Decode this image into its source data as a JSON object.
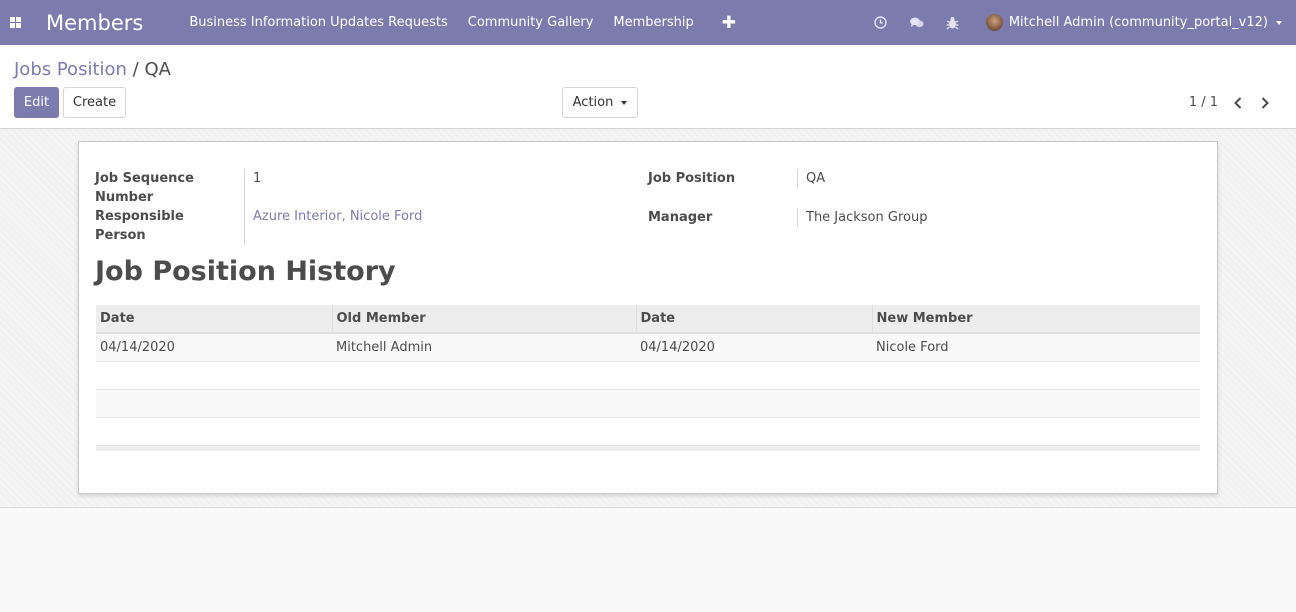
{
  "navbar": {
    "app_title": "Members",
    "menu": [
      "Business Information Updates Requests",
      "Community Gallery",
      "Membership"
    ],
    "add_symbol": "✚",
    "user": "Mitchell Admin (community_portal_v12)"
  },
  "control_panel": {
    "breadcrumb_parent": "Jobs Position",
    "breadcrumb_sep": " / ",
    "breadcrumb_current": "QA",
    "edit_label": "Edit",
    "create_label": "Create",
    "action_label": "Action",
    "pager": "1 / 1"
  },
  "form": {
    "job_sequence_label": "Job Sequence Number",
    "job_sequence_value": "1",
    "responsible_label": "Responsible Person",
    "responsible_value": "Azure Interior, Nicole Ford",
    "job_position_label": "Job Position",
    "job_position_value": "QA",
    "manager_label": "Manager",
    "manager_value": "The Jackson Group"
  },
  "history": {
    "title": "Job Position History",
    "columns": [
      "Date",
      "Old Member",
      "Date",
      "New Member"
    ],
    "rows": [
      [
        "04/14/2020",
        "Mitchell Admin",
        "04/14/2020",
        "Nicole Ford"
      ]
    ]
  },
  "colors": {
    "brand": "#7c7bad"
  }
}
